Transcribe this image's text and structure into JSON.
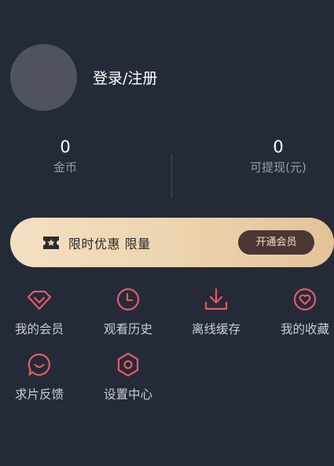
{
  "profile": {
    "login_label": "登录/注册"
  },
  "stats": [
    {
      "value": "0",
      "label": "金币"
    },
    {
      "value": "0",
      "label": "可提现(元)"
    }
  ],
  "vip_banner": {
    "text": "限时优惠 限量",
    "button_label": "开通会员"
  },
  "menu": [
    {
      "label": "我的会员",
      "icon": "diamond-icon"
    },
    {
      "label": "观看历史",
      "icon": "clock-icon"
    },
    {
      "label": "离线缓存",
      "icon": "download-icon"
    },
    {
      "label": "我的收藏",
      "icon": "heart-icon"
    },
    {
      "label": "求片反馈",
      "icon": "chat-bubble-icon"
    },
    {
      "label": "设置中心",
      "icon": "gear-icon"
    }
  ],
  "colors": {
    "background": "#252a38",
    "accent": "#e15a68",
    "vip_gold": "#ecd3ad",
    "vip_button": "#4b3634"
  }
}
